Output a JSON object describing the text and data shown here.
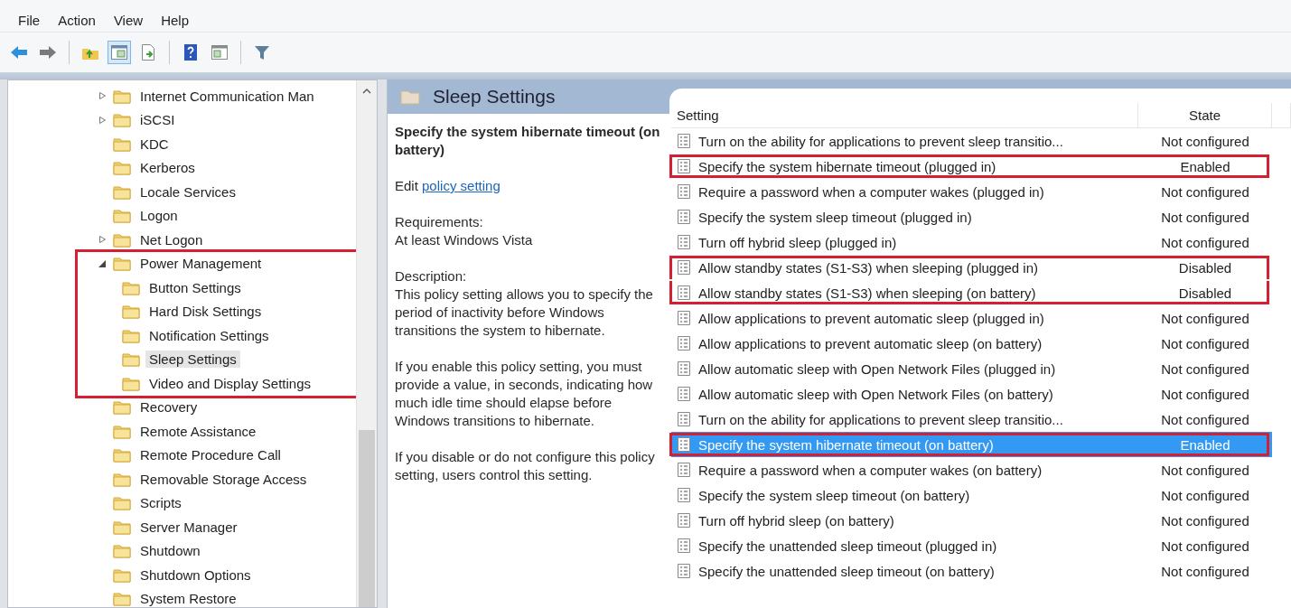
{
  "menu": [
    "File",
    "Action",
    "View",
    "Help"
  ],
  "toolbar": [
    [
      {
        "kind": "back"
      },
      {
        "kind": "forward"
      }
    ],
    [
      {
        "kind": "up"
      },
      {
        "kind": "tree",
        "pressed": true
      },
      {
        "kind": "export"
      }
    ],
    [
      {
        "kind": "help"
      },
      {
        "kind": "pane",
        "pressed": false
      }
    ],
    [
      {
        "kind": "filter"
      }
    ]
  ],
  "tree": {
    "items": [
      {
        "label": "Internet Communication Man",
        "expanded": false,
        "selected": false,
        "boxed": false
      },
      {
        "label": "iSCSI",
        "expanded": false,
        "selected": false,
        "boxed": false
      },
      {
        "label": "KDC",
        "selected": false,
        "boxed": false
      },
      {
        "label": "Kerberos",
        "selected": false,
        "boxed": false
      },
      {
        "label": "Locale Services",
        "selected": false,
        "boxed": false
      },
      {
        "label": "Logon",
        "selected": false,
        "boxed": false
      },
      {
        "label": "Net Logon",
        "expanded": false,
        "selected": false,
        "boxed": false
      },
      {
        "label": "Power Management",
        "expanded": true,
        "selected": false,
        "boxed": true,
        "children": [
          {
            "label": "Button Settings",
            "selected": false,
            "boxed": true
          },
          {
            "label": "Hard Disk Settings",
            "selected": false,
            "boxed": true
          },
          {
            "label": "Notification Settings",
            "selected": false,
            "boxed": true
          },
          {
            "label": "Sleep Settings",
            "selected": true,
            "boxed": true
          },
          {
            "label": "Video and Display Settings",
            "selected": false,
            "boxed": true
          }
        ]
      },
      {
        "label": "Recovery",
        "selected": false,
        "boxed": false
      },
      {
        "label": "Remote Assistance",
        "selected": false,
        "boxed": false
      },
      {
        "label": "Remote Procedure Call",
        "selected": false,
        "boxed": false
      },
      {
        "label": "Removable Storage Access",
        "selected": false,
        "boxed": false
      },
      {
        "label": "Scripts",
        "selected": false,
        "boxed": false
      },
      {
        "label": "Server Manager",
        "selected": false,
        "boxed": false
      },
      {
        "label": "Shutdown",
        "selected": false,
        "boxed": false
      },
      {
        "label": "Shutdown Options",
        "selected": false,
        "boxed": false
      },
      {
        "label": "System Restore",
        "selected": false,
        "boxed": false
      }
    ]
  },
  "pane": {
    "title": "Sleep Settings"
  },
  "details": {
    "title": "Specify the system hibernate timeout (on battery)",
    "edit_prefix": "Edit",
    "edit_link": "policy setting",
    "requirements_label": "Requirements:",
    "requirements": "At least Windows Vista",
    "description_label": "Description:",
    "paragraphs": [
      "This policy setting allows you to specify the period of inactivity before Windows transitions the system to hibernate.",
      "If you enable this policy setting, you must provide a value, in seconds, indicating how much idle time should elapse before Windows transitions to hibernate.",
      "If you disable or do not configure this policy setting, users control this setting."
    ]
  },
  "list": {
    "columns": [
      "Setting",
      "State"
    ],
    "rows": [
      {
        "setting": "Turn on the ability for applications to prevent sleep transitio...",
        "state": "Not configured",
        "selected": false,
        "boxed": false
      },
      {
        "setting": "Specify the system hibernate timeout (plugged in)",
        "state": "Enabled",
        "selected": false,
        "boxed": true
      },
      {
        "setting": "Require a password when a computer wakes (plugged in)",
        "state": "Not configured",
        "selected": false,
        "boxed": false
      },
      {
        "setting": "Specify the system sleep timeout (plugged in)",
        "state": "Not configured",
        "selected": false,
        "boxed": false
      },
      {
        "setting": "Turn off hybrid sleep (plugged in)",
        "state": "Not configured",
        "selected": false,
        "boxed": false
      },
      {
        "setting": "Allow standby states (S1-S3) when sleeping (plugged in)",
        "state": "Disabled",
        "selected": false,
        "boxed": true
      },
      {
        "setting": "Allow standby states (S1-S3) when sleeping (on battery)",
        "state": "Disabled",
        "selected": false,
        "boxed": true
      },
      {
        "setting": "Allow applications to prevent automatic sleep (plugged in)",
        "state": "Not configured",
        "selected": false,
        "boxed": false
      },
      {
        "setting": "Allow applications to prevent automatic sleep (on battery)",
        "state": "Not configured",
        "selected": false,
        "boxed": false
      },
      {
        "setting": "Allow automatic sleep with Open Network Files (plugged in)",
        "state": "Not configured",
        "selected": false,
        "boxed": false
      },
      {
        "setting": "Allow automatic sleep with Open Network Files (on battery)",
        "state": "Not configured",
        "selected": false,
        "boxed": false
      },
      {
        "setting": "Turn on the ability for applications to prevent sleep transitio...",
        "state": "Not configured",
        "selected": false,
        "boxed": false
      },
      {
        "setting": "Specify the system hibernate timeout (on battery)",
        "state": "Enabled",
        "selected": true,
        "boxed": true
      },
      {
        "setting": "Require a password when a computer wakes (on battery)",
        "state": "Not configured",
        "selected": false,
        "boxed": false
      },
      {
        "setting": "Specify the system sleep timeout (on battery)",
        "state": "Not configured",
        "selected": false,
        "boxed": false
      },
      {
        "setting": "Turn off hybrid sleep (on battery)",
        "state": "Not configured",
        "selected": false,
        "boxed": false
      },
      {
        "setting": "Specify the unattended sleep timeout (plugged in)",
        "state": "Not configured",
        "selected": false,
        "boxed": false
      },
      {
        "setting": "Specify the unattended sleep timeout (on battery)",
        "state": "Not configured",
        "selected": false,
        "boxed": false
      }
    ]
  }
}
